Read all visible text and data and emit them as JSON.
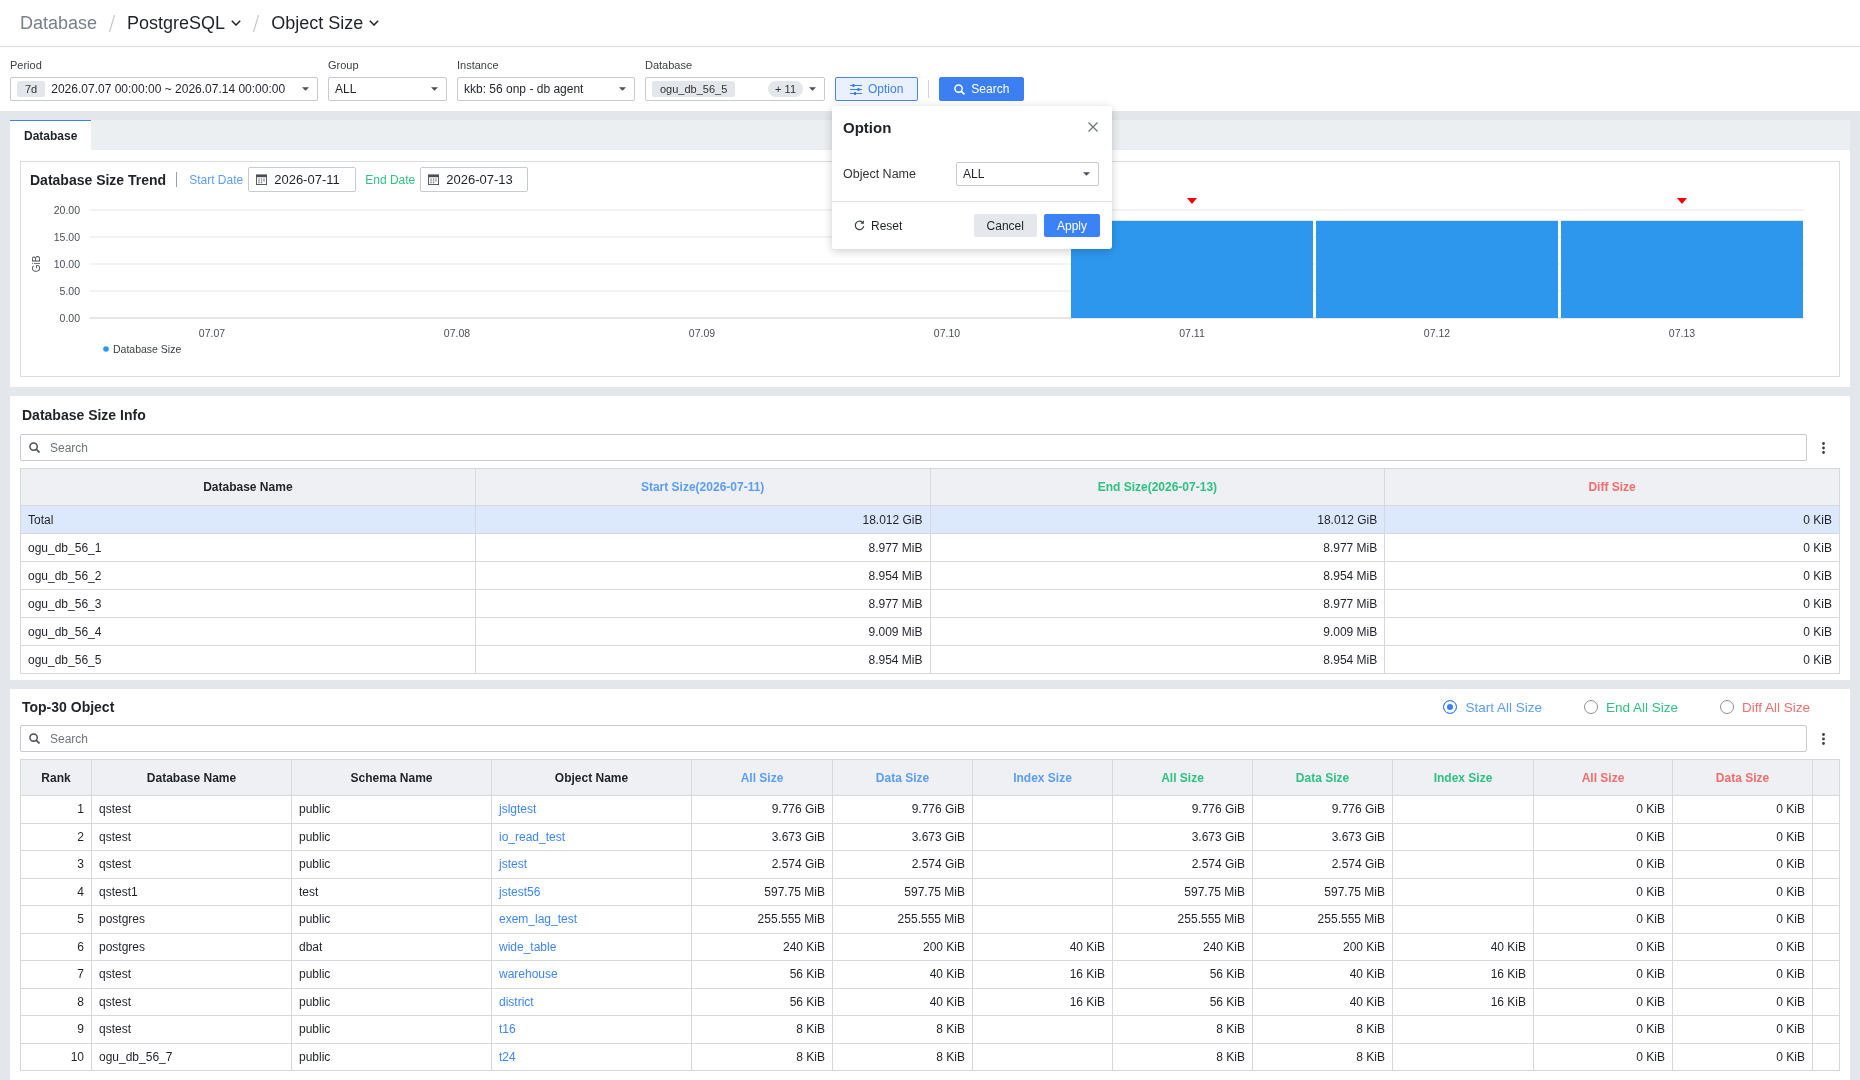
{
  "breadcrumb": [
    {
      "label": "Database",
      "dropdown": false
    },
    {
      "label": "PostgreSQL",
      "dropdown": true
    },
    {
      "label": "Object Size",
      "dropdown": true
    }
  ],
  "filters": [
    {
      "kind": "period",
      "label": "Period",
      "chip": "7d",
      "value": "2026.07.07 00:00:00 ~ 2026.07.14 00:00:00"
    },
    {
      "kind": "select",
      "label": "Group",
      "value": "ALL"
    },
    {
      "kind": "select",
      "label": "Instance",
      "value": "kkb: 56 onp - db agent"
    },
    {
      "kind": "multi",
      "label": "Database",
      "chip": "ogu_db_56_5",
      "count": "+ 11"
    }
  ],
  "actions": [
    {
      "kind": "option",
      "label": "Option"
    },
    {
      "kind": "search",
      "label": "Search"
    }
  ],
  "option_popup": {
    "title": "Option",
    "fields": [
      {
        "label": "Object Name",
        "value": "ALL"
      }
    ],
    "buttons": [
      {
        "kind": "reset",
        "label": "Reset"
      },
      {
        "kind": "cancel",
        "label": "Cancel"
      },
      {
        "kind": "apply",
        "label": "Apply"
      }
    ]
  },
  "tabs": [
    {
      "label": "Database",
      "selected": true
    }
  ],
  "trend": {
    "title": "Database Size Trend",
    "date_range": [
      {
        "label": "Start Date",
        "value": "2026-07-11",
        "color": "#5c9df5"
      },
      {
        "label": "End Date",
        "value": "2026-07-13",
        "color": "#2fc281"
      }
    ],
    "chart_data": {
      "type": "bar",
      "ylabel": "GiB",
      "categories": [
        "07.07",
        "07.08",
        "07.09",
        "07.10",
        "07.11",
        "07.12",
        "07.13"
      ],
      "series": [
        {
          "name": "Database Size",
          "color": "#2d97ee",
          "values": [
            0,
            0,
            0,
            0,
            18,
            18,
            18
          ]
        }
      ],
      "ylim": [
        0,
        20
      ],
      "yticks": [
        {
          "value": 0,
          "label": "0.00"
        },
        {
          "value": 5,
          "label": "5.00"
        },
        {
          "value": 10,
          "label": "10.00"
        },
        {
          "value": 15,
          "label": "15.00"
        },
        {
          "value": 20,
          "label": "20.00"
        }
      ],
      "grid": true,
      "annotations": [
        {
          "x": "07.11"
        },
        {
          "x": "07.13"
        }
      ]
    }
  },
  "size_info": {
    "title": "Database Size Info",
    "search": {
      "placeholder": "Search"
    },
    "columns": [
      {
        "label": "Database Name",
        "kind": "text",
        "color": "#1f2329"
      },
      {
        "label": "Start Size(2026-07-11)",
        "kind": "number",
        "color": "#5c9df5"
      },
      {
        "label": "End Size(2026-07-13)",
        "kind": "number",
        "color": "#2fc281"
      },
      {
        "label": "Diff Size",
        "kind": "number",
        "color": "#f26d6d"
      }
    ],
    "rows": [
      {
        "selected": true,
        "cells": [
          "Total",
          "18.012 GiB",
          "18.012 GiB",
          "0 KiB"
        ]
      },
      {
        "selected": false,
        "cells": [
          "ogu_db_56_1",
          "8.977 MiB",
          "8.977 MiB",
          "0 KiB"
        ]
      },
      {
        "selected": false,
        "cells": [
          "ogu_db_56_2",
          "8.954 MiB",
          "8.954 MiB",
          "0 KiB"
        ]
      },
      {
        "selected": false,
        "cells": [
          "ogu_db_56_3",
          "8.977 MiB",
          "8.977 MiB",
          "0 KiB"
        ]
      },
      {
        "selected": false,
        "cells": [
          "ogu_db_56_4",
          "9.009 MiB",
          "9.009 MiB",
          "0 KiB"
        ]
      },
      {
        "selected": false,
        "cells": [
          "ogu_db_56_5",
          "8.954 MiB",
          "8.954 MiB",
          "0 KiB"
        ]
      }
    ]
  },
  "top_objects": {
    "title": "Top-30 Object",
    "size_modes": [
      {
        "label": "Start All Size",
        "selected": true,
        "color": "#5c9df5"
      },
      {
        "label": "End All Size",
        "selected": false,
        "color": "#2fc281"
      },
      {
        "label": "Diff All Size",
        "selected": false,
        "color": "#f26d6d"
      }
    ],
    "search": {
      "placeholder": "Search"
    },
    "columns": [
      {
        "label": "Rank",
        "kind": "number",
        "color": "#1f2329"
      },
      {
        "label": "Database Name",
        "kind": "text",
        "color": "#1f2329"
      },
      {
        "label": "Schema Name",
        "kind": "text",
        "color": "#1f2329"
      },
      {
        "label": "Object Name",
        "kind": "link",
        "color": "#1f2329"
      },
      {
        "label": "All Size",
        "kind": "number",
        "color": "#5c9df5"
      },
      {
        "label": "Data Size",
        "kind": "number",
        "color": "#5c9df5"
      },
      {
        "label": "Index Size",
        "kind": "number",
        "color": "#5c9df5"
      },
      {
        "label": "All Size",
        "kind": "number",
        "color": "#2fc281"
      },
      {
        "label": "Data Size",
        "kind": "number",
        "color": "#2fc281"
      },
      {
        "label": "Index Size",
        "kind": "number",
        "color": "#2fc281"
      },
      {
        "label": "All Size",
        "kind": "number",
        "color": "#f26d6d"
      },
      {
        "label": "Data Size",
        "kind": "number",
        "color": "#f26d6d"
      }
    ],
    "rows": [
      [
        "1",
        "qstest",
        "public",
        "jslgtest",
        "9.776 GiB",
        "9.776 GiB",
        null,
        "9.776 GiB",
        "9.776 GiB",
        null,
        "0 KiB",
        "0 KiB"
      ],
      [
        "2",
        "qstest",
        "public",
        "io_read_test",
        "3.673 GiB",
        "3.673 GiB",
        null,
        "3.673 GiB",
        "3.673 GiB",
        null,
        "0 KiB",
        "0 KiB"
      ],
      [
        "3",
        "qstest",
        "public",
        "jstest",
        "2.574 GiB",
        "2.574 GiB",
        null,
        "2.574 GiB",
        "2.574 GiB",
        null,
        "0 KiB",
        "0 KiB"
      ],
      [
        "4",
        "qstest1",
        "test",
        "jstest56",
        "597.75 MiB",
        "597.75 MiB",
        null,
        "597.75 MiB",
        "597.75 MiB",
        null,
        "0 KiB",
        "0 KiB"
      ],
      [
        "5",
        "postgres",
        "public",
        "exem_lag_test",
        "255.555 MiB",
        "255.555 MiB",
        null,
        "255.555 MiB",
        "255.555 MiB",
        null,
        "0 KiB",
        "0 KiB"
      ],
      [
        "6",
        "postgres",
        "dbat",
        "wide_table",
        "240 KiB",
        "200 KiB",
        "40 KiB",
        "240 KiB",
        "200 KiB",
        "40 KiB",
        "0 KiB",
        "0 KiB"
      ],
      [
        "7",
        "qstest",
        "public",
        "warehouse",
        "56 KiB",
        "40 KiB",
        "16 KiB",
        "56 KiB",
        "40 KiB",
        "16 KiB",
        "0 KiB",
        "0 KiB"
      ],
      [
        "8",
        "qstest",
        "public",
        "district",
        "56 KiB",
        "40 KiB",
        "16 KiB",
        "56 KiB",
        "40 KiB",
        "16 KiB",
        "0 KiB",
        "0 KiB"
      ],
      [
        "9",
        "qstest",
        "public",
        "t16",
        "8 KiB",
        "8 KiB",
        null,
        "8 KiB",
        "8 KiB",
        null,
        "0 KiB",
        "0 KiB"
      ],
      [
        "10",
        "ogu_db_56_7",
        "public",
        "t24",
        "8 KiB",
        "8 KiB",
        null,
        "8 KiB",
        "8 KiB",
        null,
        "0 KiB",
        "0 KiB"
      ]
    ]
  }
}
